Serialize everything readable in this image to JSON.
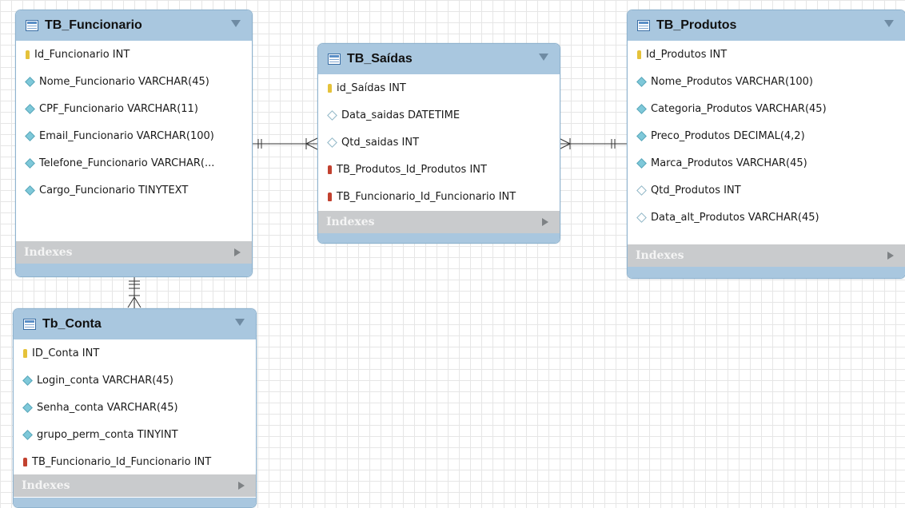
{
  "tables": {
    "funcionario": {
      "name": "TB_Funcionario",
      "columns": [
        {
          "label": "Id_Funcionario INT",
          "icon": "primary-key-icon"
        },
        {
          "label": "Nome_Funcionario VARCHAR(45)",
          "icon": "column-diamond-icon"
        },
        {
          "label": "CPF_Funcionario VARCHAR(11)",
          "icon": "column-diamond-icon"
        },
        {
          "label": "Email_Funcionario VARCHAR(100)",
          "icon": "column-diamond-icon"
        },
        {
          "label": "Telefone_Funcionario VARCHAR(...",
          "icon": "column-diamond-icon"
        },
        {
          "label": "Cargo_Funcionario TINYTEXT",
          "icon": "column-diamond-icon"
        }
      ],
      "indexes_label": "Indexes"
    },
    "saidas": {
      "name": "TB_Saídas",
      "columns": [
        {
          "label": "id_Saídas INT",
          "icon": "primary-key-icon"
        },
        {
          "label": "Data_saidas DATETIME",
          "icon": "nullable-column-icon"
        },
        {
          "label": "Qtd_saidas INT",
          "icon": "nullable-column-icon"
        },
        {
          "label": "TB_Produtos_Id_Produtos INT",
          "icon": "foreign-key-icon"
        },
        {
          "label": "TB_Funcionario_Id_Funcionario INT",
          "icon": "foreign-key-icon"
        }
      ],
      "indexes_label": "Indexes"
    },
    "produtos": {
      "name": "TB_Produtos",
      "columns": [
        {
          "label": "Id_Produtos INT",
          "icon": "primary-key-icon"
        },
        {
          "label": "Nome_Produtos VARCHAR(100)",
          "icon": "column-diamond-icon"
        },
        {
          "label": "Categoria_Produtos VARCHAR(45)",
          "icon": "column-diamond-icon"
        },
        {
          "label": "Preco_Produtos DECIMAL(4,2)",
          "icon": "column-diamond-icon"
        },
        {
          "label": "Marca_Produtos VARCHAR(45)",
          "icon": "column-diamond-icon"
        },
        {
          "label": "Qtd_Produtos INT",
          "icon": "nullable-column-icon"
        },
        {
          "label": "Data_alt_Produtos VARCHAR(45)",
          "icon": "nullable-column-icon"
        }
      ],
      "indexes_label": "Indexes"
    },
    "conta": {
      "name": "Tb_Conta",
      "columns": [
        {
          "label": "ID_Conta INT",
          "icon": "primary-key-icon"
        },
        {
          "label": "Login_conta VARCHAR(45)",
          "icon": "column-diamond-icon"
        },
        {
          "label": "Senha_conta VARCHAR(45)",
          "icon": "column-diamond-icon"
        },
        {
          "label": "grupo_perm_conta TINYINT",
          "icon": "column-diamond-icon"
        },
        {
          "label": "TB_Funcionario_Id_Funcionario INT",
          "icon": "foreign-key-icon"
        }
      ],
      "indexes_label": "Indexes"
    }
  },
  "colors": {
    "header": "#a9c7df",
    "indexes_bar": "#c9cbcd",
    "primary_key": "#e5c23a",
    "foreign_key": "#c2412f",
    "column": "#7ec8d9",
    "relationship_line": "#333333"
  }
}
